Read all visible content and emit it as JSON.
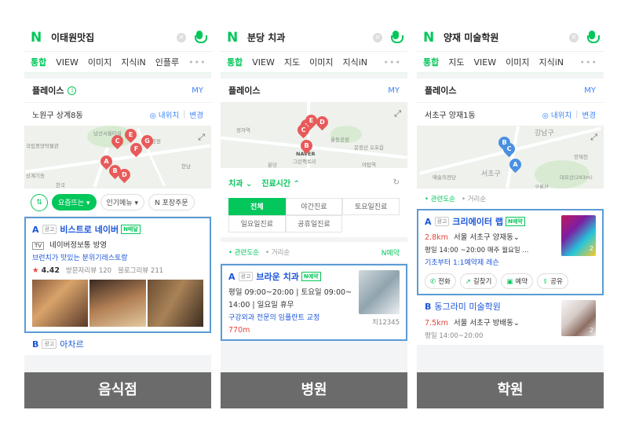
{
  "common": {
    "logo": "N",
    "clear": "×",
    "place_title": "플레이스",
    "info": "i",
    "my": "MY",
    "ad": "광고",
    "npay": "N배달",
    "nreserve": "N예약",
    "more_dots": "•••",
    "expand": "⤢",
    "nearby_btn": "◎ 내위치",
    "change_btn": "변경",
    "related": "관련도순",
    "distance": "거리순",
    "sep": "|"
  },
  "panels": [
    {
      "query": "이태원맛집",
      "tabs": [
        "통합",
        "VIEW",
        "이미지",
        "지식iN",
        "인플루"
      ],
      "location": "노원구 상계8동",
      "chips": [
        "⇅",
        "요즘뜨는 ▾",
        "인기메뉴 ▾",
        "N 포장주문"
      ],
      "map_labels": [
        "남산서울타워",
        "국립중앙박물관",
        "남산공원",
        "한남",
        "상계기동",
        "한국"
      ],
      "map_pins": [
        "A",
        "B",
        "C",
        "D",
        "E",
        "F",
        "G"
      ],
      "biz_a": {
        "letter": "A",
        "name": "비스트로 네이버",
        "line1_icon": "TV",
        "line1": "네이버정보통 방영",
        "promo": "브런치가 맛있는 분위기레스토랑",
        "rating_star": "★",
        "rating": "4.42",
        "visitor_review": "방문자리뷰 120",
        "blog_review": "블로그리뷰 211"
      },
      "biz_b": {
        "letter": "B",
        "name": "아차르"
      },
      "footer": "음식점"
    },
    {
      "query": "분당 치과",
      "tabs": [
        "통합",
        "VIEW",
        "지도",
        "이미지",
        "지식iN"
      ],
      "map_labels": [
        "정자역",
        "NAVER",
        "그린팩토리",
        "율동공원",
        "분당",
        "문정산 오포읍",
        "야탑역"
      ],
      "map_pins": [
        "A",
        "B",
        "C",
        "D",
        "E"
      ],
      "filters": {
        "category": "치과 ⌄",
        "hours": "진료시간 ⌃",
        "refresh": "↻"
      },
      "hour_options": [
        "전체",
        "야간진료",
        "토요일진료",
        "일요일진료",
        "공휴일진료"
      ],
      "biz_a": {
        "letter": "A",
        "name": "브라운 치과",
        "hours1": "평일 09:00~20:00 | 토요일 09:00~",
        "hours2": "14:00 | 일요일 휴무",
        "promo": "구강외과 전문의 임플란트 교정",
        "dist": "770m",
        "code": "치12345"
      },
      "footer": "병원"
    },
    {
      "query": "양재 미술학원",
      "tabs": [
        "통합",
        "지도",
        "VIEW",
        "이미지",
        "지식iN"
      ],
      "location": "서초구 양재1동",
      "map_labels": [
        "강남구",
        "서초구",
        "예술의전당",
        "양재천",
        "구룡산",
        "대모산(293m)"
      ],
      "map_pins": [
        "A",
        "B",
        "C"
      ],
      "biz_a": {
        "letter": "A",
        "name": "크리에이터 랩",
        "dist": "2.8km",
        "addr": "서울 서초구 양재동⌄",
        "hours": "평일 14:00 ~20:00 매주 월요일 ...",
        "promo": "기초부터 1:1예약제 레슨",
        "actions": [
          "전화",
          "길찾기",
          "예약",
          "공유"
        ],
        "thumb_count": "2"
      },
      "biz_b": {
        "letter": "B",
        "name": "동그라미 미술학원",
        "dist": "7.5km",
        "addr": "서울 서초구 방배동⌄",
        "hours": "평일 14:00~20:00",
        "thumb_count": "2"
      },
      "footer": "학원"
    }
  ]
}
